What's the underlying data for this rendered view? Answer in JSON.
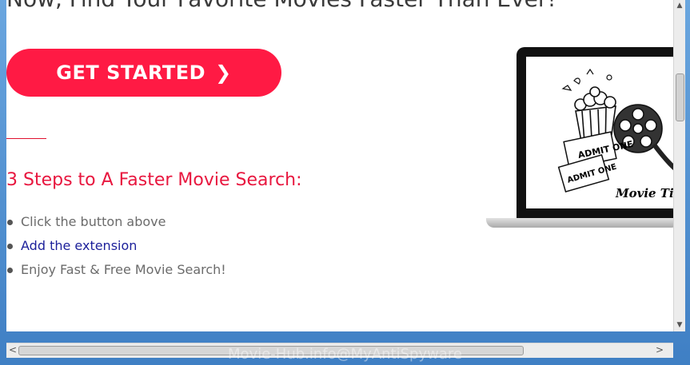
{
  "page": {
    "headline": "Now, Find Your Favorite Movies Faster Than Ever!",
    "cta_label": "GET STARTED",
    "cta_chevron": "❯",
    "steps_title": "3 Steps to A Faster Movie Search:",
    "steps": [
      "Click the button above",
      "Add the extension",
      "Enjoy Fast & Free Movie Search!"
    ],
    "promo_image_text": {
      "admit_one_a": "ADMIT ONE",
      "admit_one_b": "ADMIT ONE",
      "brand": "Movie Time"
    }
  },
  "scrollbars": {
    "up_arrow": "▲",
    "down_arrow": "▼",
    "left_arrow": "<",
    "right_arrow": ">"
  },
  "watermark": "Movie-Hub.info@MyAntiSpyware",
  "colors": {
    "accent": "#ff1a44",
    "title_red": "#e8173f",
    "link_blue": "#1b1f9a"
  }
}
